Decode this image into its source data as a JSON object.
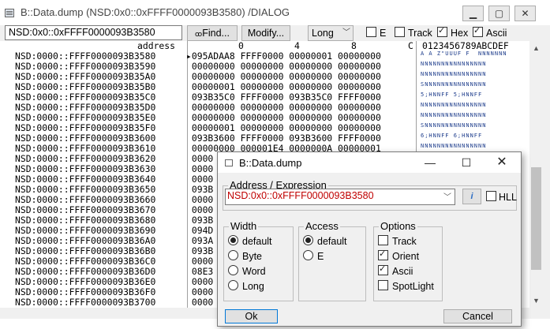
{
  "window": {
    "title": "B::Data.dump (NSD:0x0::0xFFFF0000093B3580) /DIALOG",
    "minimize_icon": "minimize-icon",
    "maximize_icon": "maximize-icon",
    "close_icon": "close-icon"
  },
  "toolbar": {
    "address_value": "NSD:0x0::0xFFFF0000093B3580",
    "find_label": "Find...",
    "modify_label": "Modify...",
    "width_value": "Long",
    "cb_e": "E",
    "cb_track": "Track",
    "cb_hex": "Hex",
    "cb_ascii": "Ascii"
  },
  "dump": {
    "header": {
      "address": "address",
      "c0": "0",
      "c4": "4",
      "c8": "8",
      "cc": "C",
      "ascii": "0123456789ABCDEF"
    },
    "rows": [
      {
        "addr": "NSD:0000::FFFF0000093B3580",
        "hex": "▸095ADAA8 FFFF0000 00000001 00000000",
        "asc": "A A Z\"UUUF F  NNNNNNN"
      },
      {
        "addr": "NSD:0000::FFFF0000093B3590",
        "hex": " 00000000 00000000 00000000 00000000",
        "asc": "NNNNNNNNNNNNNNNN"
      },
      {
        "addr": "NSD:0000::FFFF0000093B35A0",
        "hex": " 00000000 00000000 00000000 00000000",
        "asc": "NNNNNNNNNNNNNNNN"
      },
      {
        "addr": "NSD:0000::FFFF0000093B35B0",
        "hex": " 00000001 00000000 00000000 00000000",
        "asc": "SNNNNNNNNNNNNNNN"
      },
      {
        "addr": "NSD:0000::FFFF0000093B35C0",
        "hex": " 093B35C0 FFFF0000 093B35C0 FFFF0000",
        "asc": "5;HNNFF 5;HNNFF"
      },
      {
        "addr": "NSD:0000::FFFF0000093B35D0",
        "hex": " 00000000 00000000 00000000 00000000",
        "asc": "NNNNNNNNNNNNNNNN"
      },
      {
        "addr": "NSD:0000::FFFF0000093B35E0",
        "hex": " 00000000 00000000 00000000 00000000",
        "asc": "NNNNNNNNNNNNNNNN"
      },
      {
        "addr": "NSD:0000::FFFF0000093B35F0",
        "hex": " 00000001 00000000 00000000 00000000",
        "asc": "SNNNNNNNNNNNNNNN"
      },
      {
        "addr": "NSD:0000::FFFF0000093B3600",
        "hex": " 093B3600 FFFF0000 093B3600 FFFF0000",
        "asc": "6;HNNFF 6;HNNFF"
      },
      {
        "addr": "NSD:0000::FFFF0000093B3610",
        "hex": " 00000000 000001E4 0000000A 00000001",
        "asc": "NNNNNNNNNNNNNNNN"
      },
      {
        "addr": "NSD:0000::FFFF0000093B3620",
        "hex": " 0000",
        "asc": ""
      },
      {
        "addr": "NSD:0000::FFFF0000093B3630",
        "hex": " 0000",
        "asc": ""
      },
      {
        "addr": "NSD:0000::FFFF0000093B3640",
        "hex": " 0000",
        "asc": ""
      },
      {
        "addr": "NSD:0000::FFFF0000093B3650",
        "hex": " 093B",
        "asc": ""
      },
      {
        "addr": "NSD:0000::FFFF0000093B3660",
        "hex": " 0000",
        "asc": ""
      },
      {
        "addr": "NSD:0000::FFFF0000093B3670",
        "hex": " 0000",
        "asc": ""
      },
      {
        "addr": "NSD:0000::FFFF0000093B3680",
        "hex": " 093B",
        "asc": ""
      },
      {
        "addr": "NSD:0000::FFFF0000093B3690",
        "hex": " 094D",
        "asc": ""
      },
      {
        "addr": "NSD:0000::FFFF0000093B36A0",
        "hex": " 093A",
        "asc": ""
      },
      {
        "addr": "NSD:0000::FFFF0000093B36B0",
        "hex": " 093B",
        "asc": ""
      },
      {
        "addr": "NSD:0000::FFFF0000093B36C0",
        "hex": " 0000",
        "asc": ""
      },
      {
        "addr": "NSD:0000::FFFF0000093B36D0",
        "hex": " 08E3",
        "asc": ""
      },
      {
        "addr": "NSD:0000::FFFF0000093B36E0",
        "hex": " 0000",
        "asc": ""
      },
      {
        "addr": "NSD:0000::FFFF0000093B36F0",
        "hex": " 0000",
        "asc": ""
      },
      {
        "addr": "NSD:0000::FFFF0000093B3700",
        "hex": " 0000",
        "asc": ""
      }
    ]
  },
  "dialog": {
    "title": "B::Data.dump",
    "address_group": "Address / Expression",
    "expression_value": "NSD:0x0::0xFFFF0000093B3580",
    "info_icon": "info-icon",
    "hll_label": "HLL",
    "width_group": "Width",
    "width_options": [
      "default",
      "Byte",
      "Word",
      "Long"
    ],
    "access_group": "Access",
    "access_options": [
      "default",
      "E"
    ],
    "options_group": "Options",
    "options": [
      "Track",
      "Orient",
      "Ascii",
      "SpotLight"
    ],
    "ok_label": "Ok",
    "cancel_label": "Cancel"
  }
}
